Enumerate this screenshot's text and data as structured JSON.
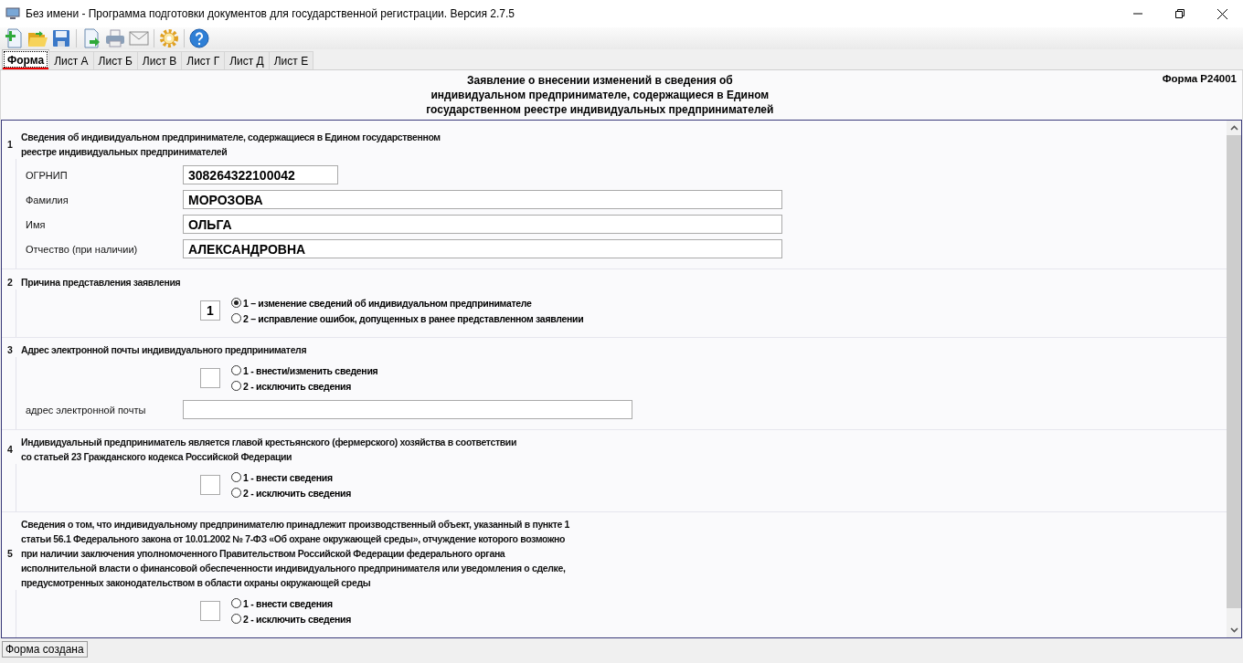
{
  "window": {
    "title": "Без имени - Программа подготовки документов для государственной регистрации. Версия 2.7.5"
  },
  "tabs": [
    {
      "label": "Форма",
      "selected": true
    },
    {
      "label": "Лист А",
      "selected": false
    },
    {
      "label": "Лист Б",
      "selected": false
    },
    {
      "label": "Лист В",
      "selected": false
    },
    {
      "label": "Лист Г",
      "selected": false
    },
    {
      "label": "Лист Д",
      "selected": false
    },
    {
      "label": "Лист Е",
      "selected": false
    }
  ],
  "header": {
    "title_lines": [
      "Заявление о внесении изменений в сведения об",
      "индивидуальном предпринимателе, содержащиеся в Едином",
      "государственном реестре индивидуальных предпринимателей"
    ],
    "form_code": "Форма Р24001"
  },
  "sections": [
    {
      "number": "1",
      "title_lines": [
        "Сведения об индивидуальном предпринимателе, содержащиеся в Едином государственном",
        "реестре индивидуальных предпринимателей"
      ],
      "fields": [
        {
          "label": "ОГРНИП",
          "value": "308264322100042",
          "kind": "short"
        },
        {
          "label": "Фамилия",
          "value": "МОРОЗОВА",
          "kind": "long"
        },
        {
          "label": "Имя",
          "value": "ОЛЬГА",
          "kind": "long"
        },
        {
          "label": "Отчество (при наличии)",
          "value": "АЛЕКСАНДРОВНА",
          "kind": "long"
        }
      ]
    },
    {
      "number": "2",
      "title_lines": [
        "Причина представления заявления"
      ],
      "code": "1",
      "options": [
        {
          "label": "1 – изменение сведений об индивидуальном предпринимателе",
          "selected": true
        },
        {
          "label": "2 – исправление ошибок, допущенных в ранее представленном заявлении",
          "selected": false
        }
      ]
    },
    {
      "number": "3",
      "title_lines": [
        "Адрес электронной почты индивидуального предпринимателя"
      ],
      "options": [
        {
          "label": "1 - внести/изменить сведения",
          "selected": false
        },
        {
          "label": "2 - исключить сведения",
          "selected": false
        }
      ],
      "after_fields": [
        {
          "label": "адрес электронной почты",
          "kind": "medium"
        }
      ]
    },
    {
      "number": "4",
      "title_lines": [
        "Индивидуальный предприниматель является главой крестьянского (фермерского) хозяйства в соответствии",
        "со статьей 23 Гражданского кодекса Российской Федерации"
      ],
      "options": [
        {
          "label": "1 - внести сведения",
          "selected": false
        },
        {
          "label": "2 - исключить сведения",
          "selected": false
        }
      ]
    },
    {
      "number": "5",
      "title_lines": [
        "Сведения о том, что индивидуальному предпринимателю принадлежит производственный объект, указанный в пункте 1",
        "статьи 56.1 Федерального закона от 10.01.2002 № 7-ФЗ «Об охране окружающей среды», отчуждение которого возможно",
        "при наличии заключения уполномоченного Правительством Российской Федерации федерального органа",
        "исполнительной власти о финансовой обеспеченности индивидуального предпринимателя или уведомления о сделке,",
        "предусмотренных законодательством в области охраны окружающей среды"
      ],
      "options": [
        {
          "label": "1 - внести сведения",
          "selected": false
        },
        {
          "label": "2 - исключить сведения",
          "selected": false
        }
      ]
    }
  ],
  "status_bar": {
    "text": "Форма создана"
  }
}
